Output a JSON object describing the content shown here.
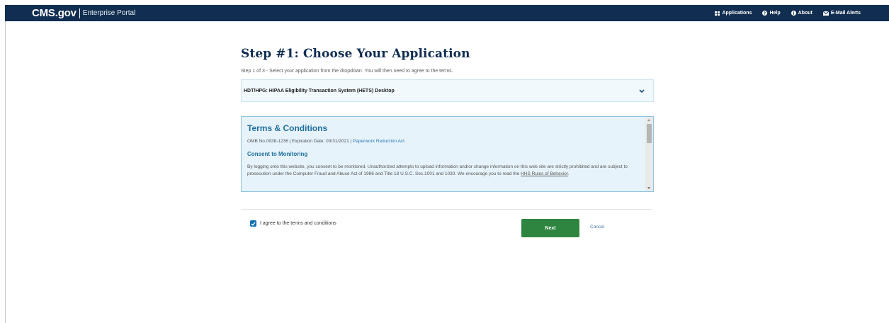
{
  "header": {
    "brand_name": "CMS.gov",
    "portal_name": "Enterprise Portal",
    "nav": [
      {
        "label": "Applications",
        "icon": "grid-icon"
      },
      {
        "label": "Help",
        "icon": "question-circle-icon"
      },
      {
        "label": "About",
        "icon": "info-circle-icon"
      },
      {
        "label": "E-Mail Alerts",
        "icon": "envelope-icon"
      }
    ]
  },
  "main": {
    "title": "Step #1: Choose Your Application",
    "subtitle": "Step 1 of 3 - Select your application from the dropdown. You will then need to agree to the terms.",
    "dropdown": {
      "selected": "HDT/HPG: HIPAA Eligibility Transaction System (HETS) Desktop",
      "icon": "chevron-down-icon"
    },
    "terms": {
      "heading": "Terms & Conditions",
      "omb_text": "OMB No.0938-1236 | Expiration Date: 03/31/2021 | ",
      "omb_link": "Paperwork Reduction Act",
      "consent_heading": "Consent to Monitoring",
      "consent_text": "By logging onto this website, you consent to be monitored. Unauthorized attempts to upload information and/or change information on this web site are strictly prohibited and are subject to prosecution under the Computer Fraud and Abuse Act of 1986 and Title 18 U.S.C. Sec.1001 and 1030. We encourage you to read the ",
      "rules_link": "HHS Rules of Behavior",
      "consent_end": "."
    },
    "agree": {
      "label": "I agree to the terms and conditions",
      "checked": true
    },
    "buttons": {
      "next": "Next",
      "cancel": "Cancel"
    }
  },
  "colors": {
    "header_bg": "#112e51",
    "title": "#112e51",
    "terms_bg": "#e6f3fa",
    "terms_border": "#8fc3df",
    "next_button": "#2e8540",
    "checkbox": "#0f6eb0"
  }
}
